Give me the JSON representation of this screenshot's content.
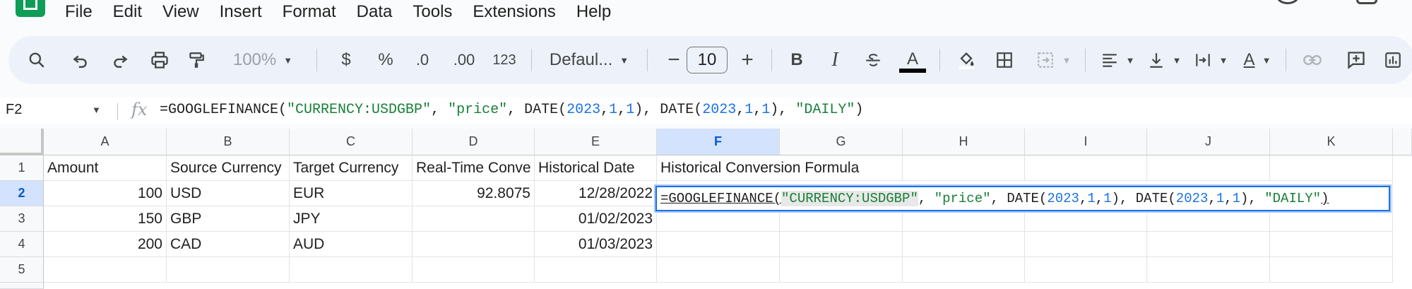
{
  "menu": [
    "File",
    "Edit",
    "View",
    "Insert",
    "Format",
    "Data",
    "Tools",
    "Extensions",
    "Help"
  ],
  "toolbar": {
    "zoom": "100%",
    "currency": "$",
    "percent": "%",
    "decrease_decimal": ".0",
    "increase_decimal": ".00",
    "number_format": "123",
    "font": "Defaul...",
    "minus": "−",
    "font_size": "10",
    "plus": "+",
    "bold": "B",
    "italic": "I",
    "text_color_letter": "A",
    "text_rotate_letter": "A",
    "text_color_bar": "#000000"
  },
  "formula_bar": {
    "name_box": "F2",
    "fx": "fx",
    "parts": [
      "=GOOGLEFINANCE(",
      "\"CURRENCY:USDGBP\"",
      ", ",
      "\"price\"",
      ", DATE(",
      "2023",
      ",",
      "1",
      ",",
      "1",
      "), DATE(",
      "2023",
      ",",
      "1",
      ",",
      "1",
      "), ",
      "\"DAILY\"",
      ")"
    ]
  },
  "columns": [
    "A",
    "B",
    "C",
    "D",
    "E",
    "F",
    "G",
    "H",
    "I",
    "J",
    "K"
  ],
  "active_column": "F",
  "rows": [
    "1",
    "2",
    "3",
    "4",
    "5"
  ],
  "active_row": "2",
  "cells": {
    "A1": "Amount",
    "B1": "Source Currency",
    "C1": "Target Currency",
    "D1": "Real-Time Conve",
    "E1": "Historical Date",
    "F1": "Historical Conversion Formula",
    "A2": "100",
    "B2": "USD",
    "C2": "EUR",
    "D2": "92.8075",
    "E2": "12/28/2022",
    "A3": "150",
    "B3": "GBP",
    "C3": "JPY",
    "E3": "01/02/2023",
    "A4": "200",
    "B4": "CAD",
    "C4": "AUD",
    "E4": "01/03/2023"
  },
  "colors": {
    "accent": "#1a73e8",
    "string": "#188038",
    "number": "#1a73e8",
    "sheets_green": "#0f9d58"
  }
}
